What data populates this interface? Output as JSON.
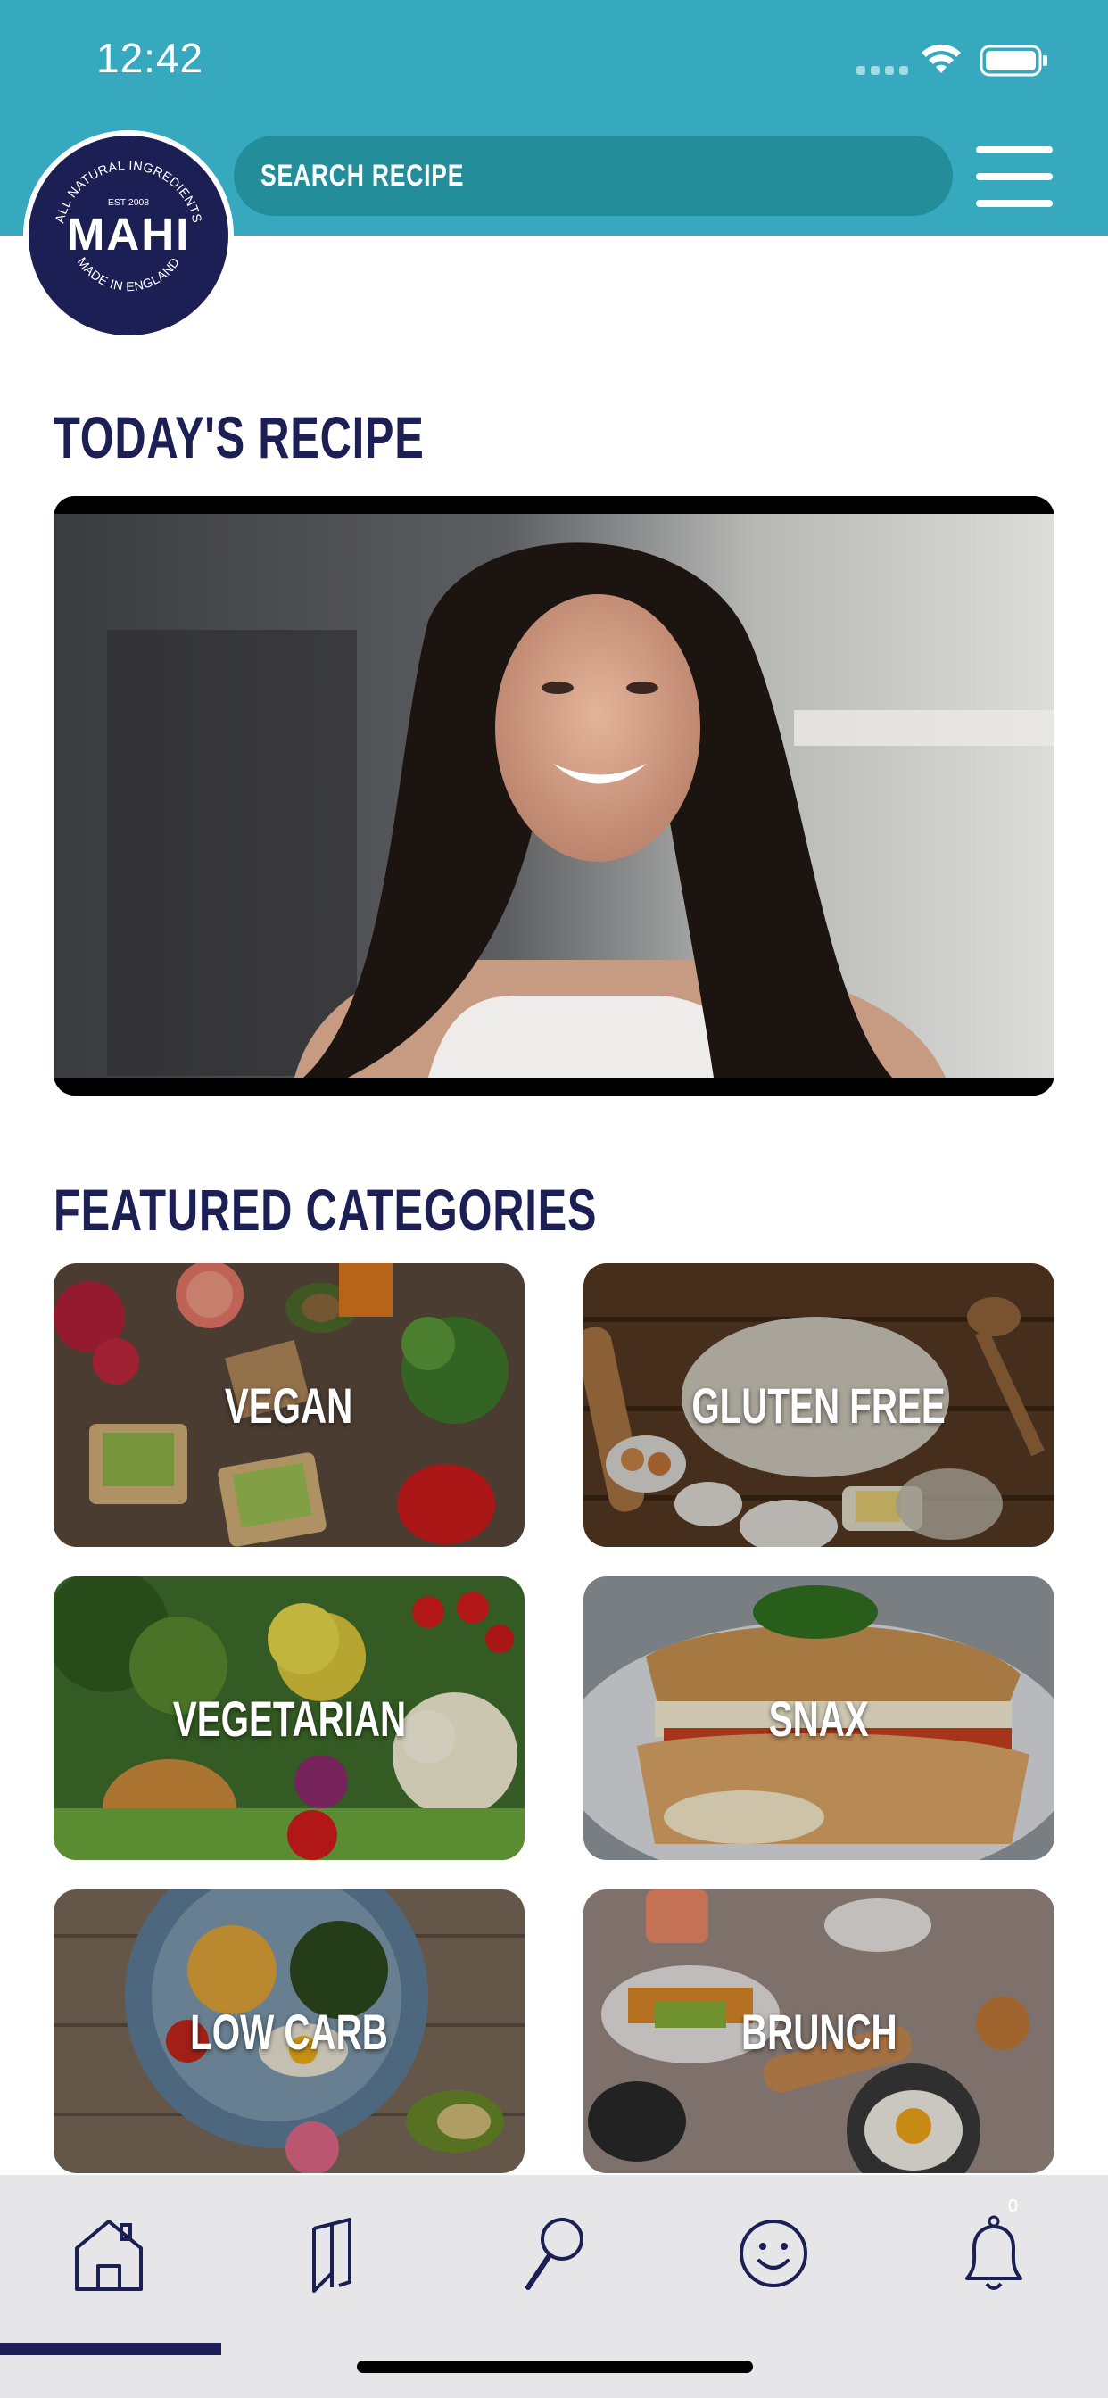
{
  "status_bar": {
    "time": "12:42"
  },
  "brand": {
    "name": "MAHI",
    "arc_top": "ALL NATURAL INGREDIENTS",
    "est": "EST 2008",
    "arc_bottom": "MADE IN ENGLAND",
    "colors": {
      "navy": "#1c1f54",
      "teal": "#37a9bf",
      "teal_dark": "#238e99"
    }
  },
  "header": {
    "search_placeholder": "SEARCH RECIPE",
    "menu_icon": "hamburger-menu-icon"
  },
  "todays_recipe": {
    "title": "TODAY'S RECIPE"
  },
  "featured": {
    "title": "FEATURED CATEGORIES",
    "categories": [
      {
        "label": "VEGAN"
      },
      {
        "label": "GLUTEN FREE"
      },
      {
        "label": "VEGETARIAN"
      },
      {
        "label": "SNAX"
      },
      {
        "label": "LOW CARB"
      },
      {
        "label": "BRUNCH"
      }
    ]
  },
  "tabbar": {
    "tabs": [
      {
        "icon": "home-icon",
        "selected": true
      },
      {
        "icon": "bookmark-icon",
        "selected": false
      },
      {
        "icon": "search-icon",
        "selected": false
      },
      {
        "icon": "smiley-icon",
        "selected": false
      },
      {
        "icon": "bell-icon",
        "selected": false
      }
    ],
    "notification_count": "0"
  }
}
